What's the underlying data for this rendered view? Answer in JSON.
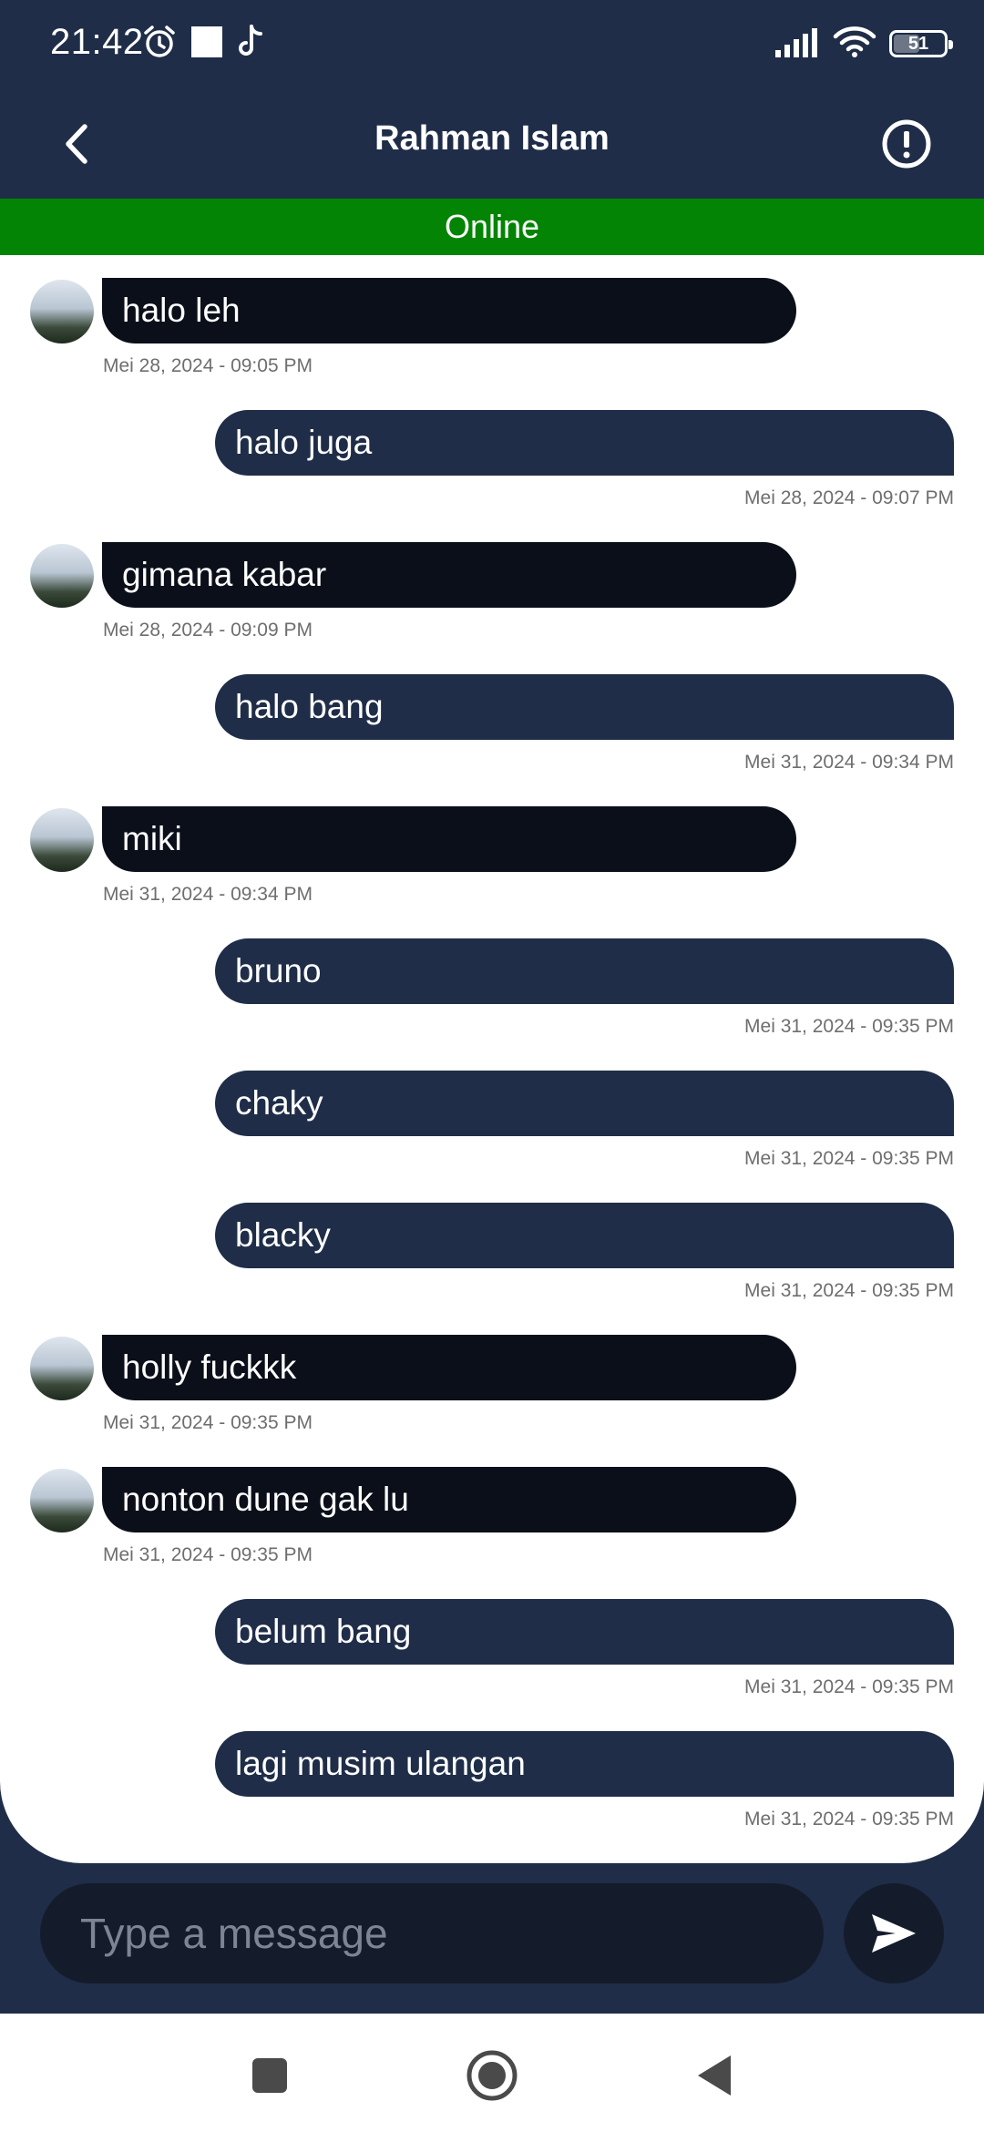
{
  "status_bar": {
    "time": "21:42",
    "battery": "51",
    "icons": [
      "alarm-icon",
      "square-notification-icon",
      "tiktok-icon",
      "signal-icon",
      "wifi-icon",
      "battery-icon"
    ]
  },
  "header": {
    "title": "Rahman Islam",
    "back_icon": "chevron-left-icon",
    "info_icon": "alert-circle-icon"
  },
  "presence": {
    "status": "Online"
  },
  "messages": [
    {
      "side": "in",
      "text": "halo leh",
      "time": "Mei 28, 2024 - 09:05 PM"
    },
    {
      "side": "out",
      "text": "halo juga",
      "time": "Mei 28, 2024 - 09:07 PM"
    },
    {
      "side": "in",
      "text": "gimana kabar",
      "time": "Mei 28, 2024 - 09:09 PM"
    },
    {
      "side": "out",
      "text": "halo bang",
      "time": "Mei 31, 2024 - 09:34 PM"
    },
    {
      "side": "in",
      "text": "miki",
      "time": "Mei 31, 2024 - 09:34 PM"
    },
    {
      "side": "out",
      "text": "bruno",
      "time": "Mei 31, 2024 - 09:35 PM"
    },
    {
      "side": "out",
      "text": "chaky",
      "time": "Mei 31, 2024 - 09:35 PM"
    },
    {
      "side": "out",
      "text": "blacky",
      "time": "Mei 31, 2024 - 09:35 PM"
    },
    {
      "side": "in",
      "text": "holly fuckkk",
      "time": "Mei 31, 2024 - 09:35 PM"
    },
    {
      "side": "in",
      "text": "nonton dune gak lu",
      "time": "Mei 31, 2024 - 09:35 PM"
    },
    {
      "side": "out",
      "text": "belum bang",
      "time": "Mei 31, 2024 - 09:35 PM"
    },
    {
      "side": "out",
      "text": "lagi musim ulangan",
      "time": "Mei 31, 2024 - 09:35 PM"
    }
  ],
  "composer": {
    "placeholder": "Type a message",
    "value": "",
    "send_icon": "send-icon"
  },
  "nav_bar": {
    "icons": [
      "recents-square-icon",
      "home-circle-icon",
      "back-triangle-icon"
    ]
  },
  "colors": {
    "header_bg": "#1f2d48",
    "online_bg": "#048404",
    "incoming_bubble": "#0a0f19",
    "outgoing_bubble": "#1f2d48",
    "timestamp": "#6e6e6e"
  }
}
